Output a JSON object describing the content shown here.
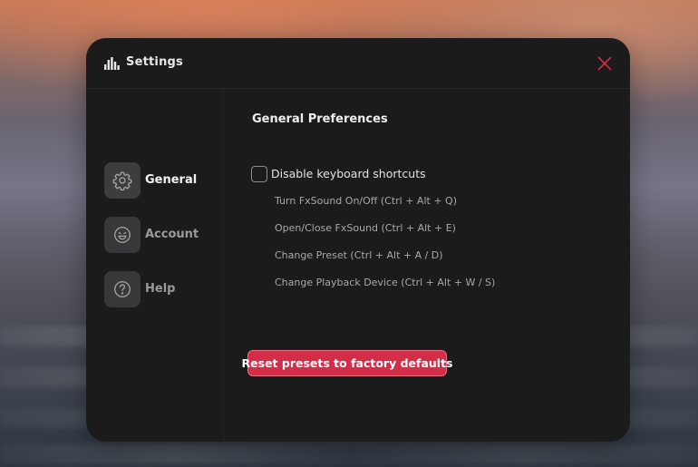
{
  "window": {
    "title": "Settings",
    "title_icon": "equalizer-bars-icon",
    "close_icon": "close-icon",
    "accent_color": "#d42d47"
  },
  "sidebar": {
    "items": [
      {
        "label": "General",
        "icon": "gear-icon",
        "active": true
      },
      {
        "label": "Account",
        "icon": "smiley-face-icon",
        "active": false
      },
      {
        "label": "Help",
        "icon": "question-circle-icon",
        "active": false
      }
    ]
  },
  "general": {
    "section_title": "General Preferences",
    "disable_shortcuts": {
      "label": "Disable keyboard shortcuts",
      "checked": false
    },
    "shortcuts": [
      "Turn FxSound On/Off (Ctrl + Alt + Q)",
      "Open/Close FxSound (Ctrl + Alt + E)",
      "Change Preset (Ctrl + Alt + A / D)",
      "Change Playback Device (Ctrl + Alt + W / S)"
    ],
    "reset_button_label": "Reset presets to factory defaults"
  }
}
